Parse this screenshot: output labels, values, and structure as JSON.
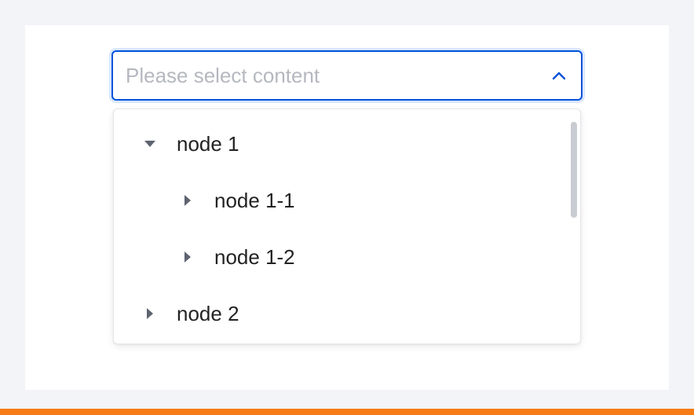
{
  "select": {
    "value": "",
    "placeholder": "Please select content",
    "indicator_icon": "chevron-up-icon"
  },
  "tree": {
    "nodes": [
      {
        "label": "node 1",
        "expanded": true,
        "icon": "caret-down-icon"
      },
      {
        "label": "node 1-1",
        "expanded": false,
        "icon": "caret-right-icon"
      },
      {
        "label": "node 1-2",
        "expanded": false,
        "icon": "caret-right-icon"
      },
      {
        "label": "node 2",
        "expanded": false,
        "icon": "caret-right-icon"
      }
    ]
  },
  "colors": {
    "accent": "#0052d9",
    "focus_ring": "#d9e6ff",
    "placeholder": "#b5b8bf",
    "text": "#232323",
    "caret": "#5e6370",
    "scrollbar": "#c9ccd2",
    "page_background": "#f3f4f8",
    "bottom_bar": "#f77b16"
  }
}
